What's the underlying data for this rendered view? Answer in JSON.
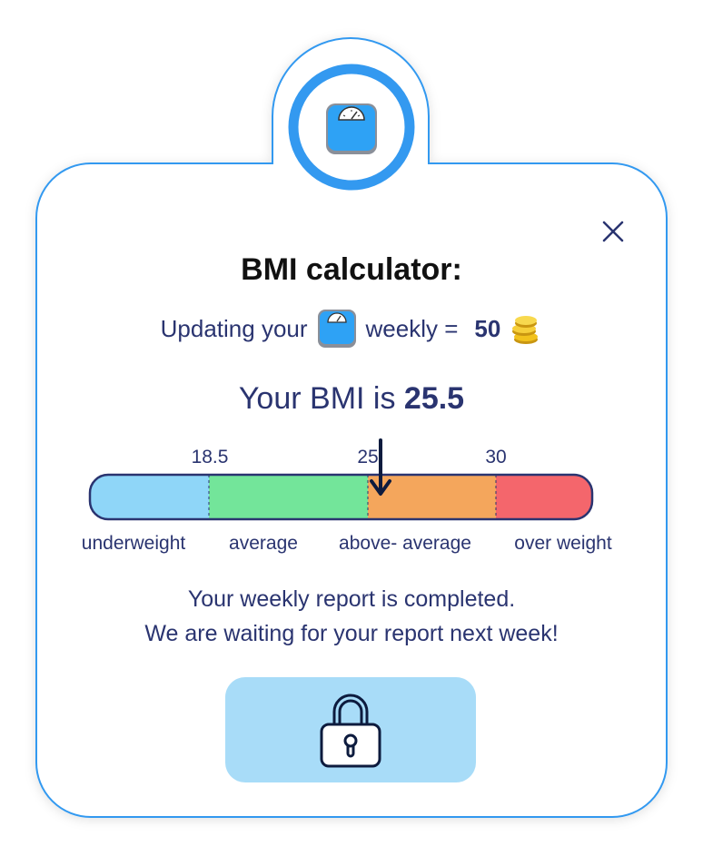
{
  "dialog": {
    "title": "BMI calculator:",
    "subtitle_prefix": "Updating your",
    "subtitle_suffix": "weekly =",
    "reward_amount": "50",
    "bmi_prefix": "Your BMI is",
    "bmi_value": "25.5",
    "bmi_numeric": 25.5
  },
  "scale": {
    "ticks": [
      "18.5",
      "25",
      "30"
    ],
    "categories": [
      "underweight",
      "average",
      "above- average",
      "over weight"
    ],
    "colors": [
      "#8fd6f8",
      "#73e59a",
      "#f4a65c",
      "#f4666c"
    ]
  },
  "messages": {
    "line1": "Your weekly report is completed.",
    "line2": "We are waiting for your report next week!"
  },
  "icons": {
    "header": "bathroom-scale-icon",
    "close": "close-icon",
    "coins": "coins-icon",
    "button": "padlock-icon"
  },
  "theme": {
    "accent": "#3399f0",
    "text": "#2a3470",
    "button_bg": "#a8dcf8"
  }
}
